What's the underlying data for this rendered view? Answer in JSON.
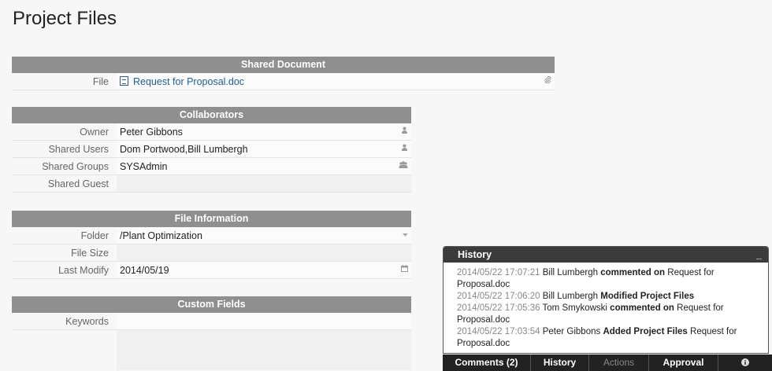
{
  "page": {
    "title": "Project Files"
  },
  "shared_document": {
    "header": "Shared Document",
    "file_label": "File",
    "file_name": "Request for Proposal.doc",
    "icon": "paperclip-icon"
  },
  "collaborators": {
    "header": "Collaborators",
    "rows": [
      {
        "label": "Owner",
        "value": "Peter Gibbons",
        "icon": "user-icon"
      },
      {
        "label": "Shared Users",
        "value": "Dom Portwood,Bill Lumbergh",
        "icon": "user-icon"
      },
      {
        "label": "Shared Groups",
        "value": "SYSAdmin",
        "icon": "group-icon"
      },
      {
        "label": "Shared Guest",
        "value": "",
        "icon": ""
      }
    ]
  },
  "file_information": {
    "header": "File Information",
    "rows": [
      {
        "label": "Folder",
        "value": "/Plant Optimization",
        "icon": "dropdown-caret-icon"
      },
      {
        "label": "File Size",
        "value": "",
        "icon": ""
      },
      {
        "label": "Last Modify",
        "value": "2014/05/19",
        "icon": "calendar-icon"
      }
    ]
  },
  "custom_fields": {
    "header": "Custom Fields",
    "rows": [
      {
        "label": "Keywords",
        "value": ""
      }
    ]
  },
  "history": {
    "title": "History",
    "minimize_label": "_",
    "entries": [
      {
        "timestamp": "2014/05/22 17:07:21",
        "user": "Bill Lumbergh",
        "action": "commented on",
        "target": "Request for Proposal.doc"
      },
      {
        "timestamp": "2014/05/22 17:06:20",
        "user": "Bill Lumbergh",
        "action": "Modified Project Files",
        "target": ""
      },
      {
        "timestamp": "2014/05/22 17:05:36",
        "user": "Tom Smykowski",
        "action": "commented on",
        "target": "Request for Proposal.doc"
      },
      {
        "timestamp": "2014/05/22 17:03:54",
        "user": "Peter Gibbons",
        "action": "Added Project Files",
        "target": "Request for Proposal.doc"
      }
    ]
  },
  "bottom_bar": {
    "comments": "Comments (2)",
    "history": "History",
    "actions": "Actions",
    "approval": "Approval",
    "info_icon": "info-icon"
  }
}
